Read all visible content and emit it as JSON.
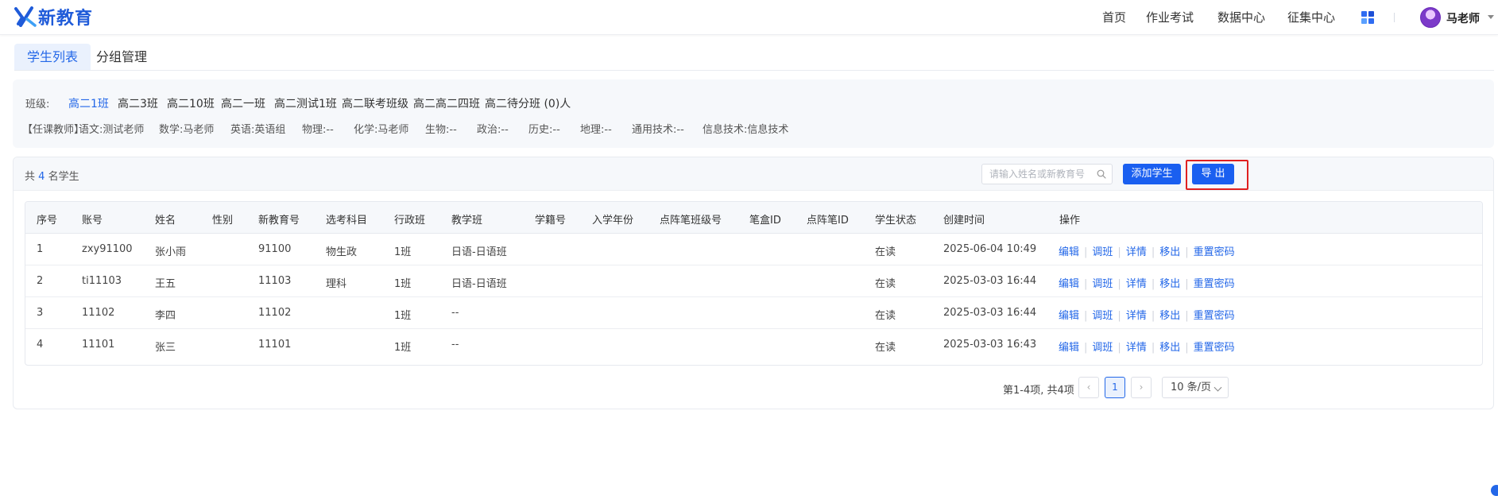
{
  "brand": {
    "name": "新教育"
  },
  "nav": {
    "items": [
      {
        "label": "首页"
      },
      {
        "label": "作业考试"
      },
      {
        "label": "数据中心"
      },
      {
        "label": "征集中心"
      }
    ],
    "apps_icon": "apps-grid-icon",
    "user_name": "马老师"
  },
  "tabs": [
    {
      "label": "学生列表",
      "active": true
    },
    {
      "label": "分组管理",
      "active": false
    }
  ],
  "filter": {
    "class_label": "班级:",
    "classes": [
      {
        "label": "高二1班",
        "active": true
      },
      {
        "label": "高二3班"
      },
      {
        "label": "高二10班"
      },
      {
        "label": "高二一班"
      },
      {
        "label": "高二测试1班"
      },
      {
        "label": "高二联考班级"
      },
      {
        "label": "高二高二四班"
      },
      {
        "label": "高二待分班 (0)人"
      }
    ],
    "teacher_label": "【任课教师】",
    "teachers": [
      {
        "text": "语文:测试老师"
      },
      {
        "text": "数学:马老师"
      },
      {
        "text": "英语:英语组"
      },
      {
        "text": "物理:--"
      },
      {
        "text": "化学:马老师"
      },
      {
        "text": "生物:--"
      },
      {
        "text": "政治:--"
      },
      {
        "text": "历史:--"
      },
      {
        "text": "地理:--"
      },
      {
        "text": "通用技术:--"
      },
      {
        "text": "信息技术:信息技术"
      }
    ]
  },
  "toolbar": {
    "total_prefix": "共",
    "total_count": "4",
    "total_suffix": "名学生",
    "search_placeholder": "请输入姓名或新教育号",
    "add_label": "添加学生",
    "export_label": "导 出"
  },
  "table": {
    "columns": [
      "序号",
      "账号",
      "姓名",
      "性别",
      "新教育号",
      "选考科目",
      "行政班",
      "教学班",
      "学籍号",
      "入学年份",
      "点阵笔班级号",
      "笔盒ID",
      "点阵笔ID",
      "学生状态",
      "创建时间",
      "操作"
    ],
    "rows": [
      {
        "idx": "1",
        "account": "zxy91100",
        "name": "张小雨",
        "gender": "",
        "edu_no": "91100",
        "subjects": "物生政",
        "admin_class": "1班",
        "teach_class": "日语-日语班",
        "status": "在读",
        "created": "2025-06-04 10:49"
      },
      {
        "idx": "2",
        "account": "ti11103",
        "name": "王五",
        "gender": "",
        "edu_no": "11103",
        "subjects": "理科",
        "admin_class": "1班",
        "teach_class": "日语-日语班",
        "status": "在读",
        "created": "2025-03-03 16:44"
      },
      {
        "idx": "3",
        "account": "11102",
        "name": "李四",
        "gender": "",
        "edu_no": "11102",
        "subjects": "",
        "admin_class": "1班",
        "teach_class": "--",
        "status": "在读",
        "created": "2025-03-03 16:44"
      },
      {
        "idx": "4",
        "account": "11101",
        "name": "张三",
        "gender": "",
        "edu_no": "11101",
        "subjects": "",
        "admin_class": "1班",
        "teach_class": "--",
        "status": "在读",
        "created": "2025-03-03 16:43"
      }
    ],
    "ops": [
      "编辑",
      "调班",
      "详情",
      "移出",
      "重置密码"
    ]
  },
  "pagination": {
    "summary": "第1-4项, 共4项",
    "prev": "‹",
    "current": "1",
    "next": "›",
    "page_size": "10 条/页"
  },
  "colors": {
    "accent": "#2367e8",
    "primary_button": "#1a5ff0",
    "highlight_frame": "#e02020"
  }
}
